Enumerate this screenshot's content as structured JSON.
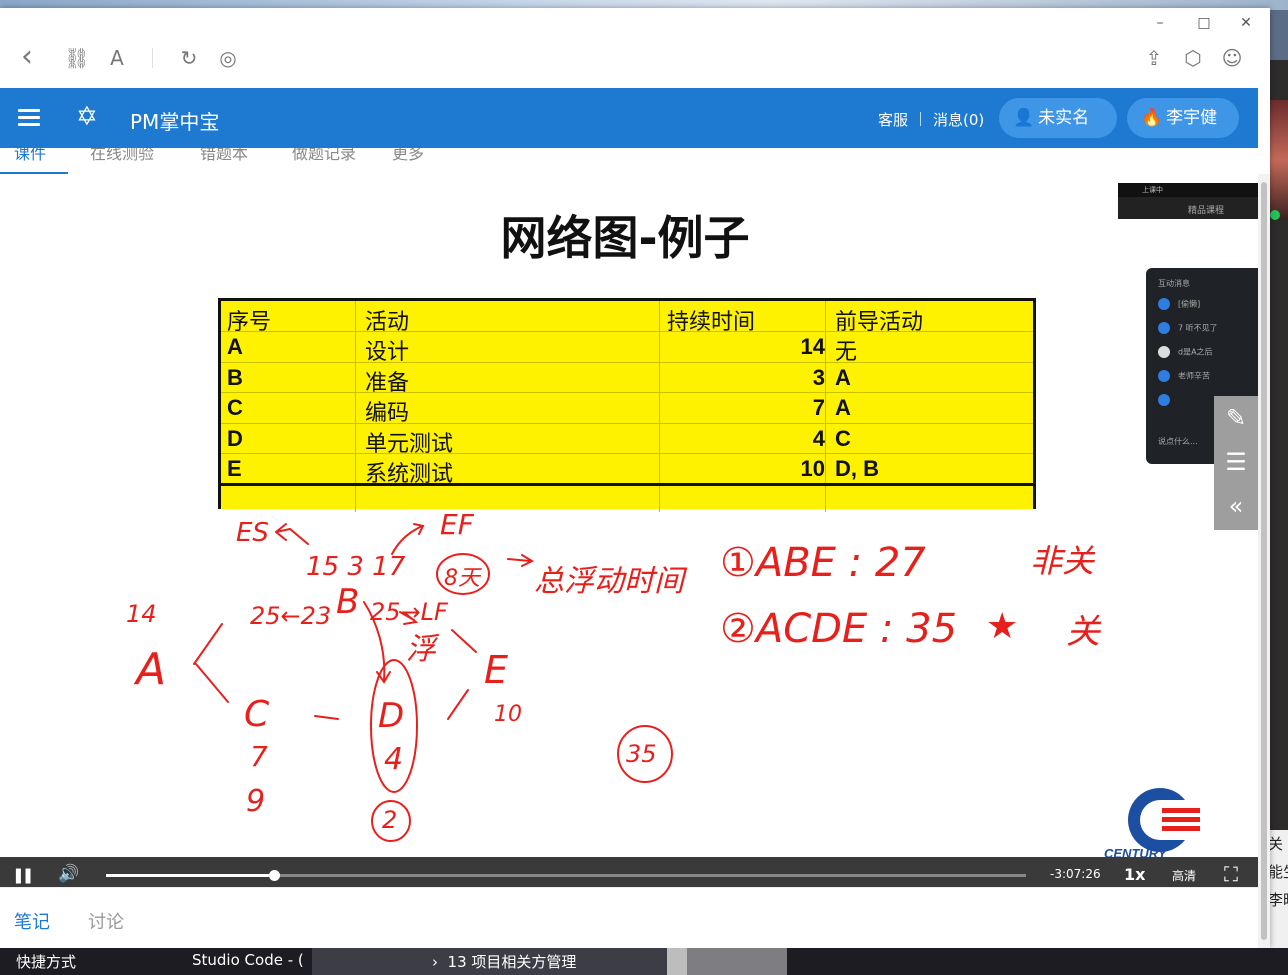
{
  "browser": {
    "back_icon": "‹",
    "link_icon": "⛓",
    "font_icon": "A",
    "reload_icon": "↻",
    "compass_icon": "◎",
    "share_icon": "⇪",
    "box_icon": "⬡",
    "user_icon": "☺",
    "minimize": "–",
    "maximize": "□",
    "close": "✕"
  },
  "app": {
    "title": "PM掌中宝",
    "service": "客服",
    "messages": "消息(0)",
    "unverified": "未实名",
    "user_name": "李宇健",
    "brand_color": "#1e79d0"
  },
  "subtabs": [
    "课件",
    "在线测验",
    "错题本",
    "做题记录",
    "更多"
  ],
  "slide": {
    "title": "网络图-例子",
    "table": {
      "headers": [
        "序号",
        "活动",
        "持续时间",
        "前导活动"
      ],
      "rows": [
        [
          "A",
          "设计",
          "14",
          "无"
        ],
        [
          "B",
          "准备",
          "3",
          "A"
        ],
        [
          "C",
          "编码",
          "7",
          "A"
        ],
        [
          "D",
          "单元测试",
          "4",
          "C"
        ],
        [
          "E",
          "系统测试",
          "10",
          "D, B"
        ]
      ]
    }
  },
  "handwriting": {
    "es": "ES",
    "ef": "EF",
    "b_times": "15 3 17",
    "b_node": "B",
    "float": "8天",
    "total_float": "总浮动时间",
    "a_dur": "14",
    "a_node": "A",
    "ls_lf": "25←23",
    "lf": "25→LF",
    "float_label": "浮",
    "e_node": "E",
    "c_node": "C",
    "d_node": "D",
    "d_dur": "4",
    "c_dur": "7",
    "c_end": "9",
    "d_circ": "2",
    "e_dur": "10",
    "total": "35",
    "path1": "①ABE : 27",
    "path2": "②ACDE : 35",
    "star": "★",
    "non_critical": "非关",
    "critical": "关"
  },
  "overlay": {
    "cam_label": "上课中",
    "cam_brand": "精品课程",
    "chat_title": "互动消息",
    "chat_lines": [
      "[偷懒]",
      "7 听不见了",
      "d是A之后",
      "老师辛苦",
      ""
    ],
    "chat_input": "说点什么...",
    "edit_icon": "✎",
    "comment_icon": "☰",
    "collapse_icon": "«",
    "brand": "CENTURY"
  },
  "player": {
    "pause_icon": "❚❚",
    "volume_icon": "🔊",
    "time_remaining": "-3:07:26",
    "speed": "1x",
    "quality": "高清",
    "fullscreen_icon": "⛶",
    "progress": 0.183
  },
  "notes": {
    "tab_notes": "笔记",
    "tab_discuss": "讨论",
    "active_color": "#1e79d0"
  },
  "taskbar": {
    "item1": "快捷方式",
    "item2": "Studio Code  - (",
    "item3": "13 项目相关方管理"
  },
  "desktop_side": {
    "line1": "关",
    "line2": "能生",
    "line3": "李旷"
  }
}
